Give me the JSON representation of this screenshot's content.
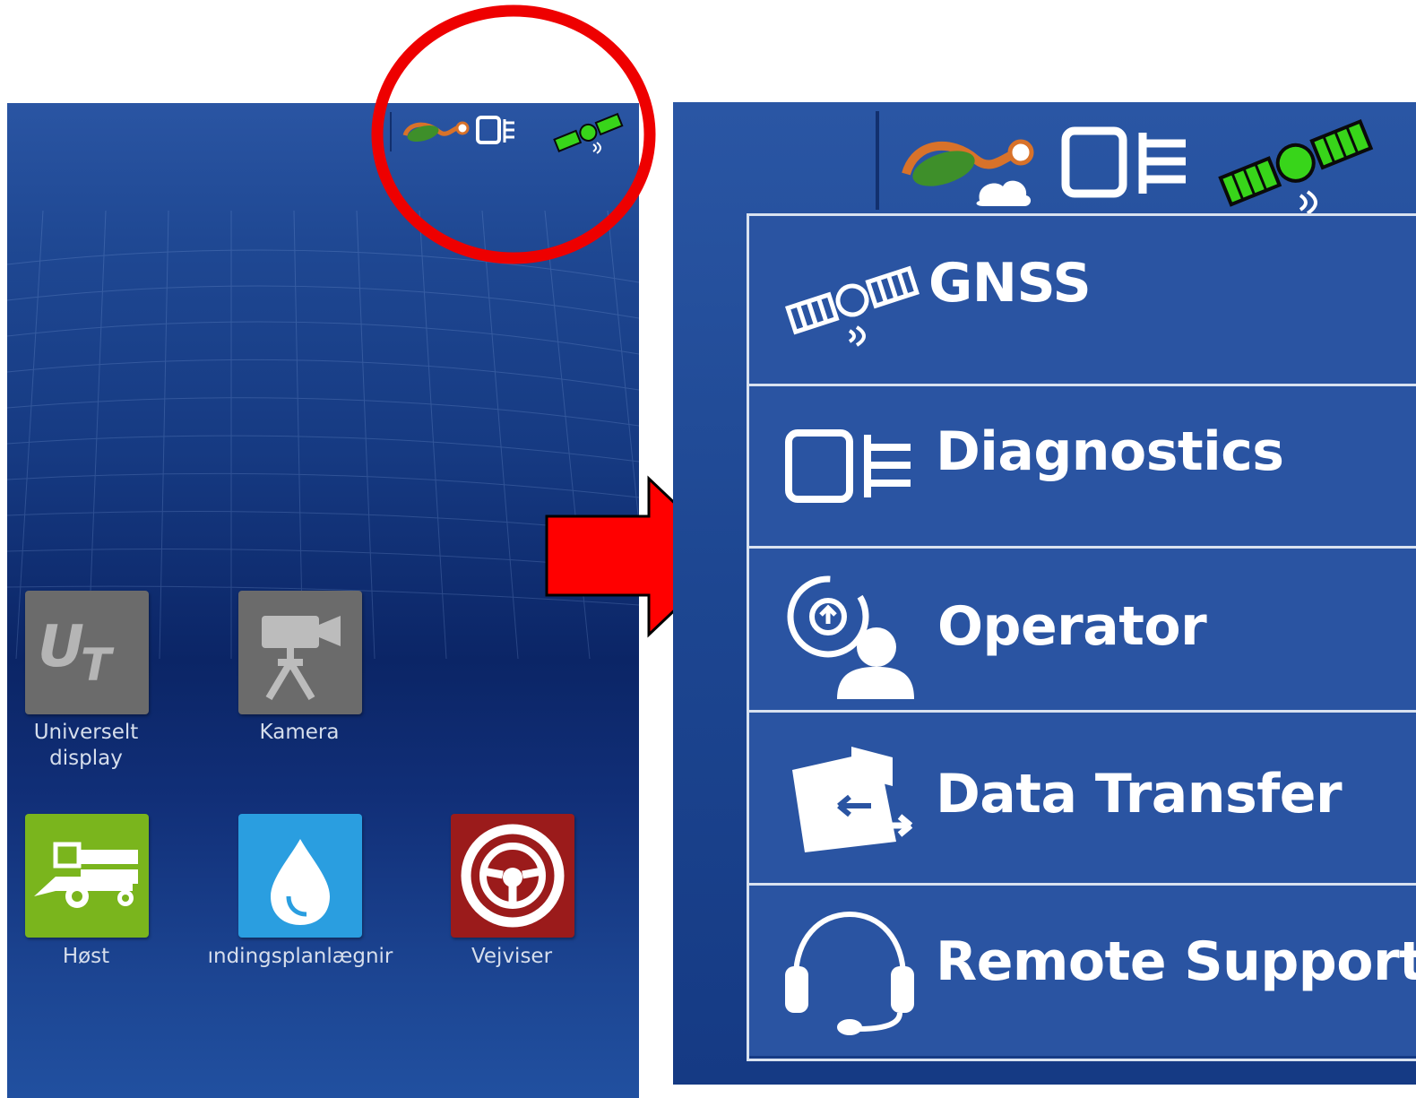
{
  "left": {
    "apps": [
      {
        "label": "Universelt\ndisplay",
        "icon": "universal-terminal-icon",
        "color": "#666666"
      },
      {
        "label": "Kamera",
        "icon": "camera-icon",
        "color": "#666666"
      },
      {
        "label": "Høst",
        "icon": "combine-harvester-icon",
        "color": "#7ab51d"
      },
      {
        "label": "Udbringningsplanlægning",
        "visible_label": "ındingsplanlægnir",
        "icon": "water-drop-icon",
        "color": "#2a9ee0"
      },
      {
        "label": "Vejviser",
        "icon": "steering-wheel-icon",
        "color": "#9b1b1b"
      }
    ],
    "status_icons": [
      "cloud-connection-icon",
      "diagnostics-icon",
      "gnss-satellite-icon"
    ]
  },
  "menu": {
    "items": [
      {
        "label": "GNSS",
        "icon": "gnss-satellite-icon"
      },
      {
        "label": "Diagnostics",
        "icon": "diagnostics-icon"
      },
      {
        "label": "Operator",
        "icon": "operator-icon"
      },
      {
        "label": "Data Transfer",
        "icon": "data-transfer-icon"
      },
      {
        "label": "Remote Support",
        "icon": "headset-icon"
      }
    ]
  },
  "colors": {
    "screen_blue": "#2a54a2",
    "annotation_red": "#ee0000",
    "satellite_green": "#38d51a"
  }
}
